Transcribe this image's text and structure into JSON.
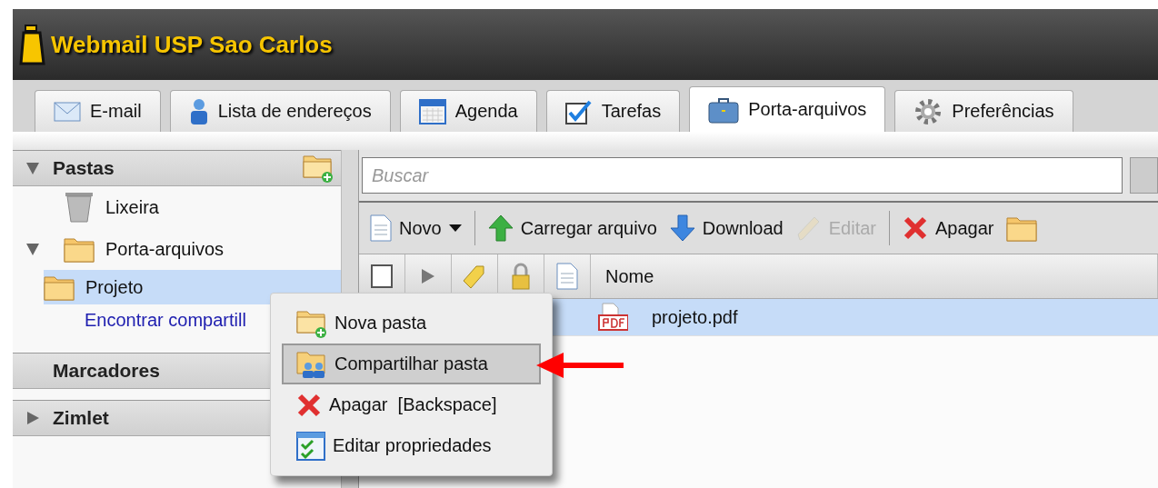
{
  "app": {
    "title": "Webmail USP Sao Carlos"
  },
  "tabs": [
    {
      "label": "E-mail",
      "kind": "mail",
      "selected": false
    },
    {
      "label": "Lista de endereços",
      "kind": "person",
      "selected": false
    },
    {
      "label": "Agenda",
      "kind": "calendar",
      "selected": false
    },
    {
      "label": "Tarefas",
      "kind": "task",
      "selected": false
    },
    {
      "label": "Porta-arquivos",
      "kind": "briefcase",
      "selected": true
    },
    {
      "label": "Preferências",
      "kind": "gear",
      "selected": false
    }
  ],
  "sidebar": {
    "sections": [
      {
        "title": "Pastas",
        "expanded": true,
        "items": [
          {
            "label": "Lixeira",
            "kind": "trash",
            "selected": false
          },
          {
            "label": "Porta-arquivos",
            "kind": "folder",
            "selected": false,
            "expanded": true,
            "children": [
              {
                "label": "Projeto",
                "kind": "folder",
                "selected": true
              }
            ]
          }
        ],
        "link": "Encontrar compartill"
      },
      {
        "title": "Marcadores"
      },
      {
        "title": "Zimlet",
        "expanded": false
      }
    ]
  },
  "search": {
    "placeholder": "Buscar"
  },
  "toolbar": {
    "groups": [
      {
        "buttons": [
          {
            "label": "Novo",
            "kind": "document",
            "menu": true,
            "disabled": false
          }
        ]
      },
      {
        "buttons": [
          {
            "label": "Carregar arquivo",
            "kind": "upload",
            "disabled": false
          },
          {
            "label": "Download",
            "kind": "download",
            "disabled": false
          },
          {
            "label": "Editar",
            "kind": "pencil",
            "disabled": true
          }
        ]
      },
      {
        "buttons": [
          {
            "label": "Apagar",
            "kind": "delete",
            "disabled": false
          },
          {
            "kind": "folder",
            "disabled": false
          }
        ]
      }
    ]
  },
  "table": {
    "columns": [
      {
        "kind": "checkbox",
        "checked": false
      },
      {
        "kind": "flag"
      },
      {
        "kind": "tag"
      },
      {
        "kind": "lock"
      },
      {
        "kind": "file"
      },
      {
        "kind": "text",
        "label": "Nome"
      }
    ],
    "rows": [
      {
        "kind": "pdf",
        "name": "projeto.pdf",
        "selected": true
      }
    ]
  },
  "context_menu": {
    "items": [
      {
        "label": "Nova pasta",
        "kind": "new-folder",
        "selected": false
      },
      {
        "label": "Compartilhar pasta",
        "kind": "share",
        "selected": true
      },
      {
        "label": "Apagar  [Backspace]",
        "kind": "delete",
        "selected": false
      },
      {
        "label": "Editar propriedades",
        "kind": "properties",
        "selected": false
      }
    ]
  }
}
